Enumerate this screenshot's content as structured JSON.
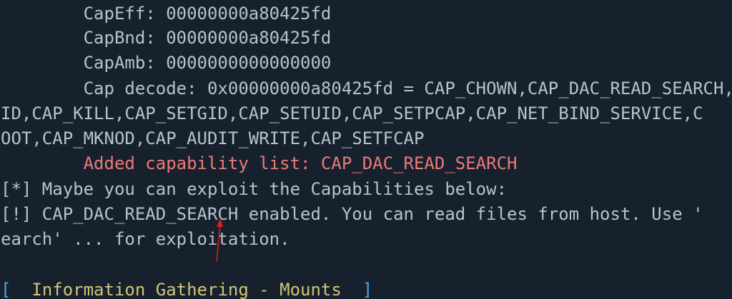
{
  "terminal": {
    "lines": [
      "        CapEff: 00000000a80425fd",
      "        CapBnd: 00000000a80425fd",
      "        CapAmb: 0000000000000000",
      "        Cap decode: 0x00000000a80425fd = CAP_CHOWN,CAP_DAC_READ_SEARCH,CAP_FOWNER,CAP_FSETID,CAP_KILL,CAP_SETGID,CAP_SETUID,CAP_SETPCAP,CAP_NET_BIND_SERVICE,C",
      "ID,CAP_KILL,CAP_SETGID,CAP_SETUID,CAP_SETPCAP,CAP_NET_BIND_SERVICE,C",
      "OOT,CAP_MKNOD,CAP_AUDIT_WRITE,CAP_SETFCAP",
      "        Added capability list: CAP_DAC_READ_SEARCH",
      "[*] Maybe you can exploit the Capabilities below:",
      "[!] CAP_DAC_READ_SEARCH enabled. You can read files from host. Use '",
      "earch' ... for exploitation."
    ],
    "section": {
      "open_bracket": "[",
      "title": "  Information Gathering - Mounts  ",
      "close_bracket": "]"
    },
    "colors": {
      "background": "#17212e",
      "text": "#b8c2cc",
      "highlight": "#ec7a7a",
      "bracket": "#4aa3e6",
      "section_title": "#d0c476",
      "annotation_arrow": "#e01b1b"
    }
  }
}
